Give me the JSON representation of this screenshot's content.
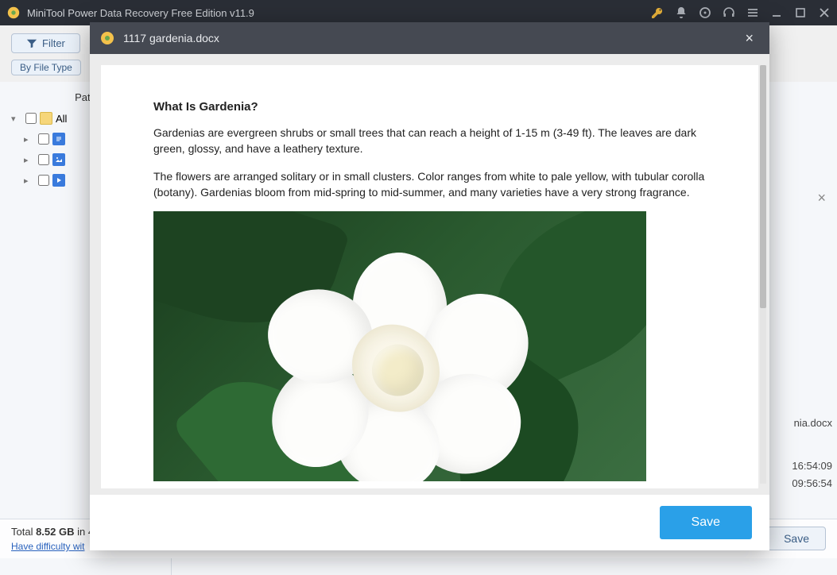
{
  "app": {
    "title": "MiniTool Power Data Recovery Free Edition v11.9"
  },
  "toolbar": {
    "filter_label": "Filter",
    "by_file_type_label": "By File Type"
  },
  "sidebar": {
    "header": "Path",
    "items": [
      {
        "label": "All"
      }
    ]
  },
  "right_hints": {
    "filename_fragment": "nia.docx",
    "time1": "16:54:09",
    "time2": "09:56:54"
  },
  "statusbar": {
    "total_prefix": "Total ",
    "total_size": "8.52 GB",
    "total_mid": " in 4",
    "help_link": "Have difficulty wit",
    "save_label": "Save"
  },
  "modal": {
    "title": "1117  gardenia.docx",
    "doc": {
      "heading": "What Is Gardenia?",
      "p1": "Gardenias are evergreen shrubs or small trees that can reach a height of 1-15 m (3-49 ft). The leaves are dark green, glossy, and have a leathery texture.",
      "p2": "The flowers are arranged solitary or in small clusters. Color ranges from white to pale yellow, with tubular corolla (botany). Gardenias bloom from mid-spring to mid-summer, and many varieties have a very strong fragrance."
    },
    "save_label": "Save"
  }
}
